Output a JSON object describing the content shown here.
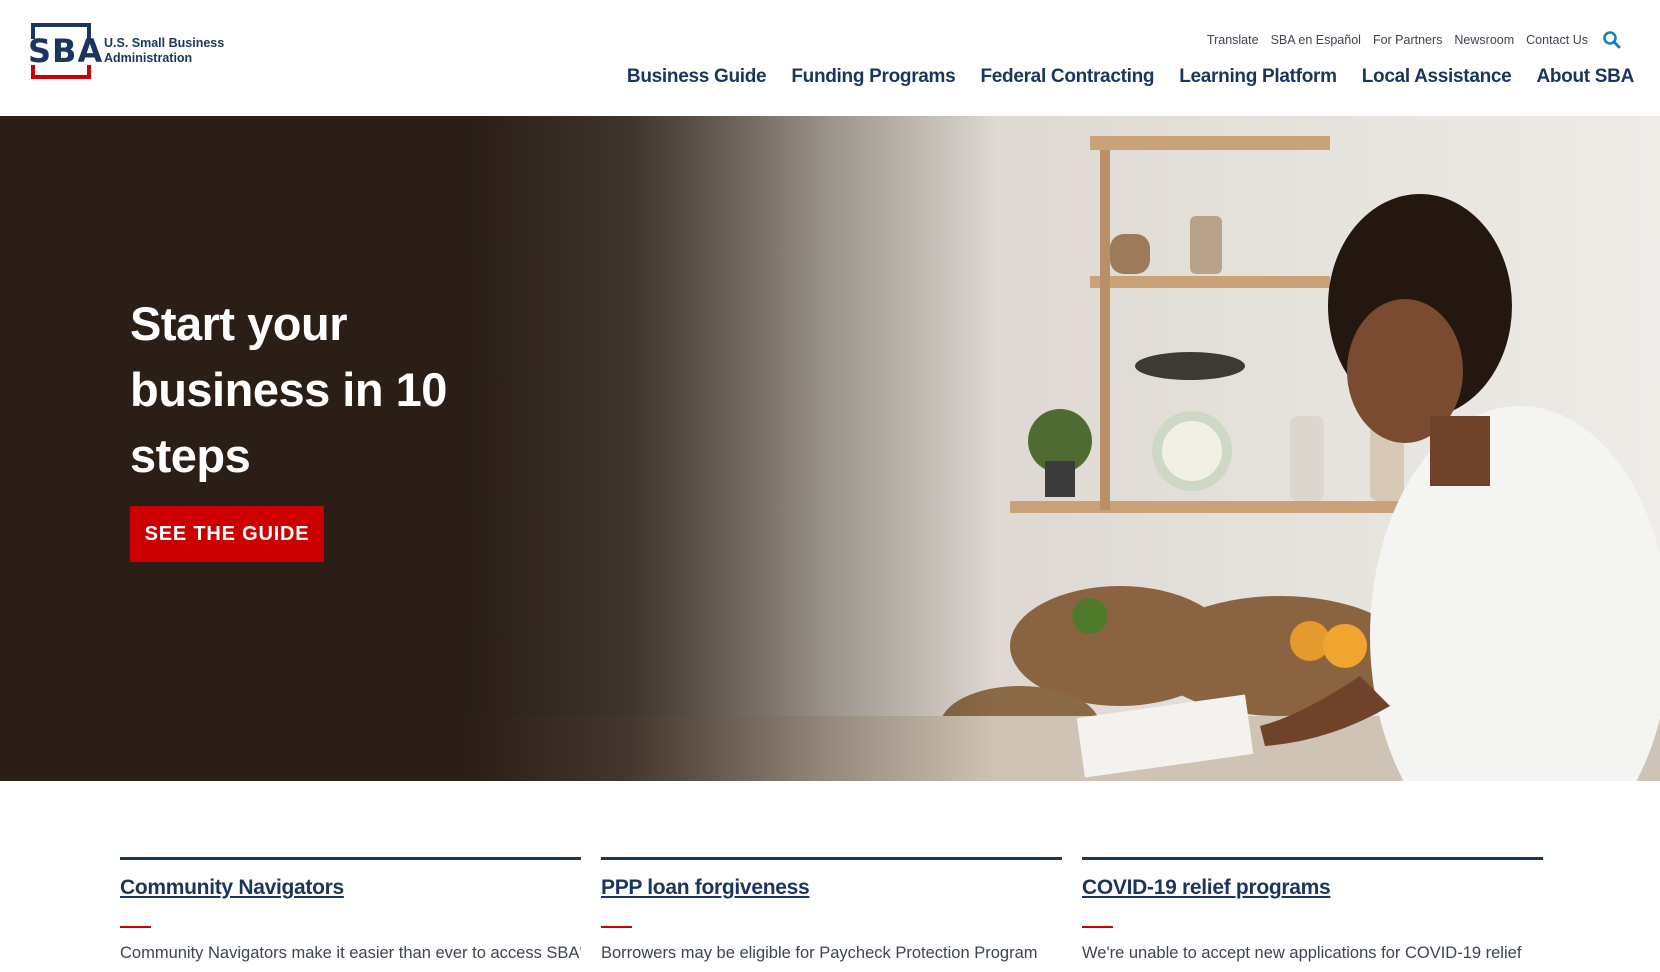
{
  "brand": {
    "logo_letters": "SBA",
    "agency_line1": "U.S. Small Business",
    "agency_line2": "Administration"
  },
  "utility_nav": [
    {
      "label": "Translate"
    },
    {
      "label": "SBA en Español"
    },
    {
      "label": "For Partners"
    },
    {
      "label": "Newsroom"
    },
    {
      "label": "Contact Us"
    }
  ],
  "search": {
    "icon": "search-icon"
  },
  "main_nav": [
    {
      "label": "Business Guide"
    },
    {
      "label": "Funding Programs"
    },
    {
      "label": "Federal Contracting"
    },
    {
      "label": "Learning Platform"
    },
    {
      "label": "Local Assistance"
    },
    {
      "label": "About SBA"
    }
  ],
  "hero": {
    "title": "Start your business in 10 steps",
    "cta_label": "SEE THE GUIDE"
  },
  "cards": [
    {
      "title": "Community Navigators",
      "text": "Community Navigators make it easier than ever to access SBA's"
    },
    {
      "title": "PPP loan forgiveness",
      "text": "Borrowers may be eligible for Paycheck Protection Program"
    },
    {
      "title": "COVID-19 relief programs",
      "text": "We're unable to accept new applications for COVID-19 relief"
    }
  ],
  "colors": {
    "navy": "#1b365d",
    "red": "#cc0000",
    "hero_dark": "#2a1e16"
  }
}
